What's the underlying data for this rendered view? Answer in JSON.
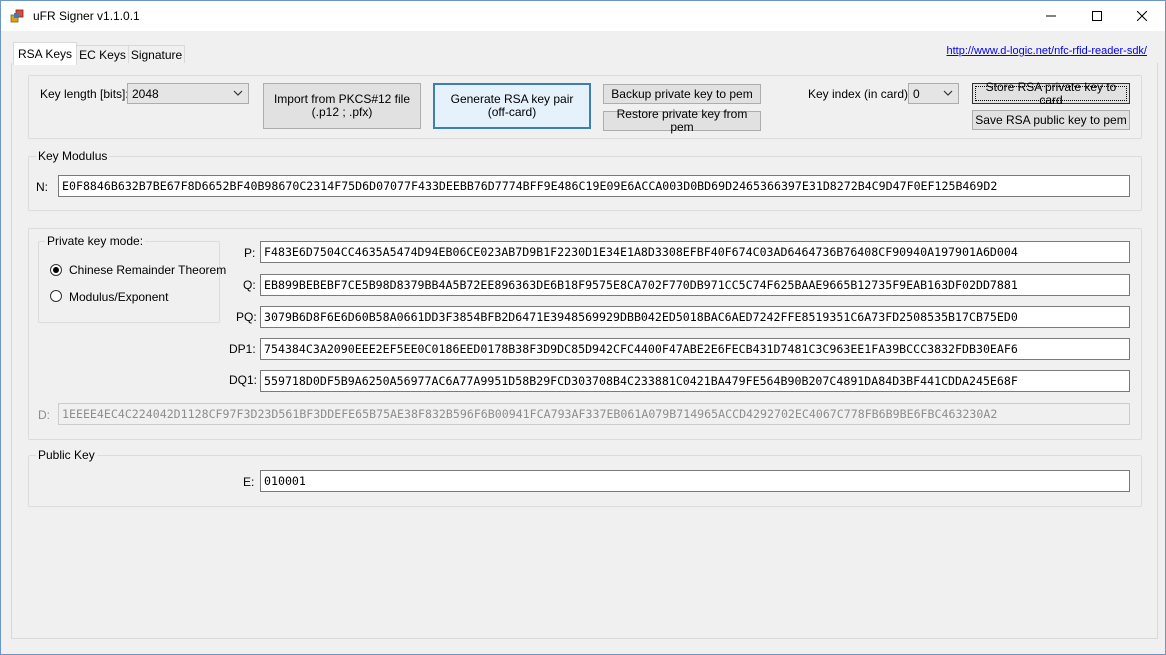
{
  "window": {
    "title": "uFR Signer v1.1.0.1",
    "minimize_icon": "minimize-icon",
    "maximize_icon": "maximize-icon",
    "close_icon": "close-icon"
  },
  "tabs": [
    {
      "label": "RSA Keys",
      "active": true
    },
    {
      "label": "EC Keys",
      "active": false
    },
    {
      "label": "Signature",
      "active": false
    }
  ],
  "link": "http://www.d-logic.net/nfc-rfid-reader-sdk/",
  "key_length": {
    "label": "Key length [bits]:",
    "value": "2048"
  },
  "buttons": {
    "import_line1": "Import from PKCS#12 file",
    "import_line2": "(.p12 ;  .pfx)",
    "generate_line1": "Generate RSA key pair",
    "generate_line2": "(off-card)",
    "backup": "Backup private key to pem",
    "restore": "Restore private key from pem",
    "store": "Store RSA private key to card",
    "save_public": "Save RSA public key to pem"
  },
  "key_index": {
    "label": "Key index (in card):",
    "value": "0"
  },
  "modulus": {
    "group_label": "Key Modulus",
    "n_label": "N:",
    "n_value": "E0F8846B632B7BE67F8D6652BF40B98670C2314F75D6D07077F433DEEBB76D7774BFF9E486C19E09E6ACCA003D0BD69D2465366397E31D8272B4C9D47F0EF125B469D2"
  },
  "private_key_mode": {
    "group_label": "Private key mode:",
    "options": [
      {
        "label": "Chinese Remainder Theorem",
        "checked": true
      },
      {
        "label": "Modulus/Exponent",
        "checked": false
      }
    ]
  },
  "crt": {
    "p_label": "P:",
    "p_value": "F483E6D7504CC4635A5474D94EB06CE023AB7D9B1F2230D1E34E1A8D3308EFBF40F674C03AD6464736B76408CF90940A197901A6D004",
    "q_label": "Q:",
    "q_value": "EB899BEBEBF7CE5B98D8379BB4A5B72EE896363DE6B18F9575E8CA702F770DB971CC5C74F625BAAE9665B12735F9EAB163DF02DD7881",
    "pq_label": "PQ:",
    "pq_value": "3079B6D8F6E6D60B58A0661DD3F3854BFB2D6471E3948569929DBB042ED5018BAC6AED7242FFE8519351C6A73FD2508535B17CB75ED0",
    "dp1_label": "DP1:",
    "dp1_value": "754384C3A2090EEE2EF5EE0C0186EED0178B38F3D9DC85D942CFC4400F47ABE2E6FECB431D7481C3C963EE1FA39BCCC3832FDB30EAF6",
    "dq1_label": "DQ1:",
    "dq1_value": "559718D0DF5B9A6250A56977AC6A77A9951D58B29FCD303708B4C233881C0421BA479FE564B90B207C4891DA84D3BF441CDDA245E68F",
    "d_label": "D:",
    "d_value": "1EEEE4EC4C224042D1128CF97F3D23D561BF3DDEFE65B75AE38F832B596F6B00941FCA793AF337EB061A079B714965ACCD4292702EC4067C778FB6B9BE6FBC463230A2"
  },
  "public_key": {
    "group_label": "Public Key",
    "e_label": "E:",
    "e_value": "010001"
  }
}
